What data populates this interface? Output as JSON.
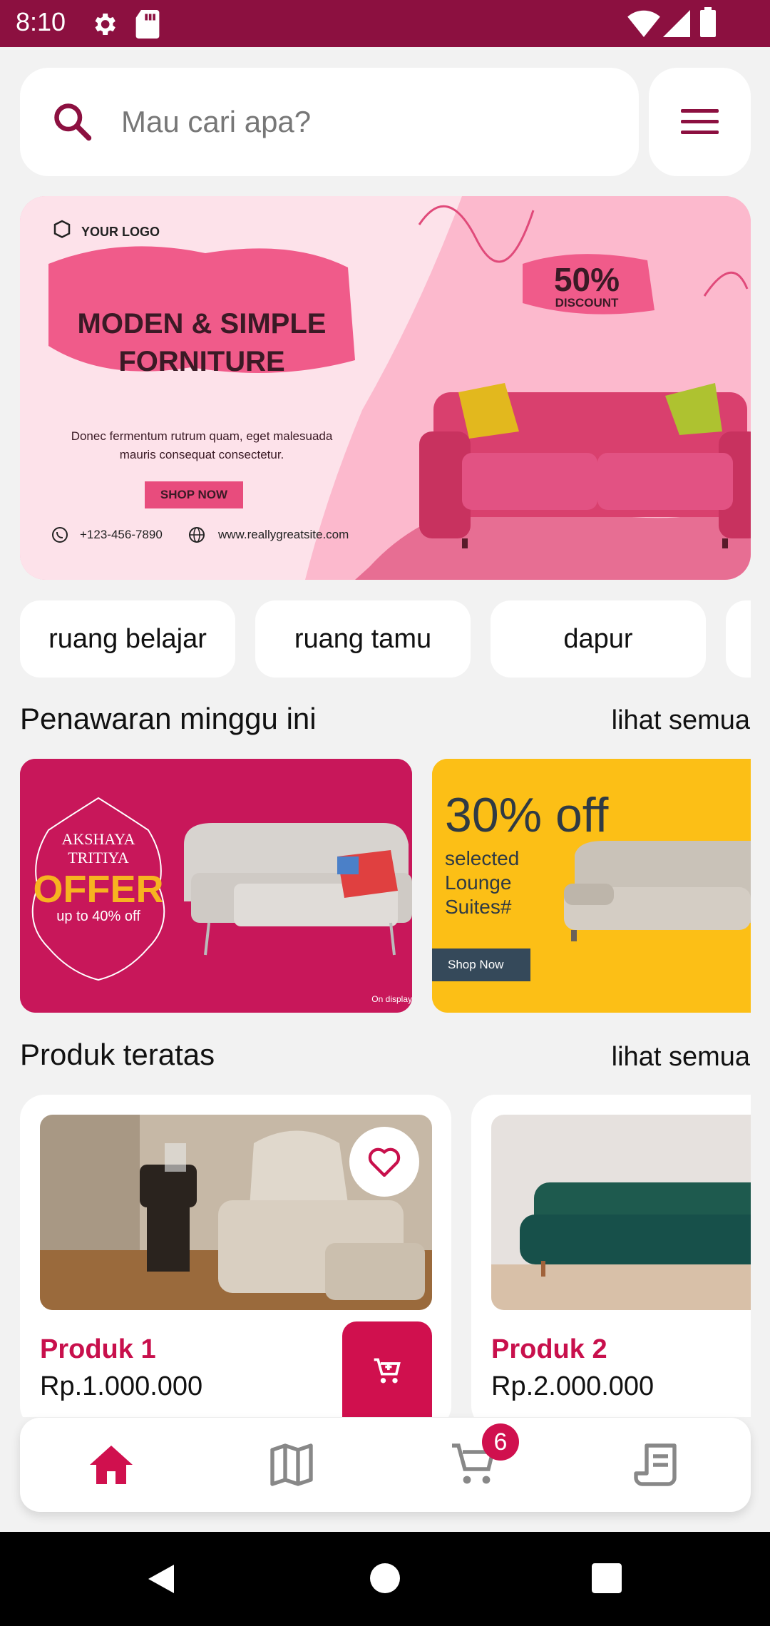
{
  "status_bar": {
    "time": "8:10",
    "icons": [
      "gear-icon",
      "sd-card-icon",
      "wifi-icon",
      "signal-icon",
      "battery-icon"
    ],
    "background": "#8c1040"
  },
  "search": {
    "placeholder": "Mau cari apa?"
  },
  "hero_banner": {
    "logo_text": "YOUR LOGO",
    "headline_line1": "MODEN & SIMPLE",
    "headline_line2": "FORNITURE",
    "body_line1": "Donec fermentum rutrum quam, eget malesuada",
    "body_line2": "mauris consequat consectetur.",
    "cta": "SHOP NOW",
    "discount_value": "50%",
    "discount_label": "DISCOUNT",
    "phone": "+123-456-7890",
    "website": "www.reallygreatsite.com"
  },
  "categories": [
    "ruang belajar",
    "ruang tamu",
    "dapur"
  ],
  "weekly_offers": {
    "title": "Penawaran minggu ini",
    "see_all": "lihat semua",
    "promo1": {
      "line1": "AKSHAYA",
      "line2": "TRITIYA",
      "line3": "OFFER",
      "line4": "up to 40% off",
      "footer": "On display"
    },
    "promo2": {
      "headline": "30% off",
      "line1": "selected",
      "line2": "Lounge",
      "line3": "Suites#",
      "cta": "Shop Now"
    }
  },
  "top_products": {
    "title": "Produk teratas",
    "see_all": "lihat semua",
    "items": [
      {
        "name": "Produk 1",
        "price": "Rp.1.000.000"
      },
      {
        "name": "Produk 2",
        "price": "Rp.2.000.000"
      }
    ]
  },
  "bottom_nav": {
    "items": [
      "home-icon",
      "map-icon",
      "cart-icon",
      "receipt-icon"
    ],
    "cart_badge": "6",
    "active_color": "#d0104e",
    "inactive_color": "#888888"
  },
  "system_nav": [
    "back-icon",
    "home-circle-icon",
    "recents-icon"
  ]
}
